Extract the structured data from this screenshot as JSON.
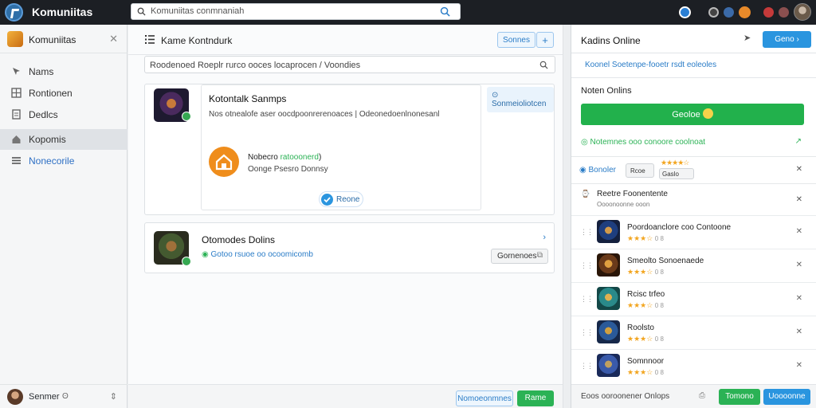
{
  "app": {
    "title": "Komuniitas",
    "search_text": "Komuniitas conmnaniah"
  },
  "sidebar": {
    "title": "Komuniitas",
    "items": [
      {
        "label": "Nams",
        "icon": "pointer-icon"
      },
      {
        "label": "Rontionen",
        "icon": "grid-icon"
      },
      {
        "label": "Dedlcs",
        "icon": "document-icon"
      },
      {
        "label": "Kopomis",
        "icon": "home-icon"
      },
      {
        "label": "Nonecorile",
        "icon": "list-icon"
      }
    ],
    "user": {
      "name": "Senmer"
    }
  },
  "main": {
    "title": "Kame Kontndurk",
    "header_button": "Sonnes",
    "header_plus": "+",
    "search_text": "Roodenoed Roeplr rurco ooces locaprocen / Voondies",
    "card1": {
      "title": "Kotontalk Sanmps",
      "description": "Nos otnealofe aser oocdpoonrerenoaces | Odeonedoenlnonesanl",
      "badge": "Sonmeioliotcen",
      "promo_title_prefix": "Nobecro ",
      "promo_title_link": "ratooonerd",
      "promo_title_suffix": ")",
      "promo_sub": "Oonge Psesro Donnsy",
      "chip": "Reone"
    },
    "card2": {
      "title": "Otomodes Dolins",
      "subtitle": "Gotoo rsuoe oo ocoomicomb",
      "button": "Gornenoes"
    },
    "footer_btn_secondary": "Nomoeonmnes",
    "footer_btn_primary": "Rame"
  },
  "right": {
    "title": "Kadins Online",
    "header_btn": "Geno",
    "search_text": "Koonel Soetenpe-fooetr rsdt eoleoles",
    "section_title": "Noten Onlins",
    "green_btn": "Geoloe",
    "status_text": "Notemnes ooo conoore coolnoat",
    "chip_label": "Bonoler",
    "chip_btn1": "Rcoe",
    "chip_btn2": "Gaslo",
    "item_hdr_title": "Reetre Foonentente",
    "item_hdr_sub": "Oooonoonne ooon",
    "items": [
      {
        "name": "Poordoanclore coo Contoone",
        "stars": "★★★☆",
        "score": "0 8"
      },
      {
        "name": "Smeolto Sonoenaede",
        "stars": "★★★☆",
        "score": "0 8"
      },
      {
        "name": "Rcisc trfeo",
        "stars": "★★★☆",
        "score": "0 8"
      },
      {
        "name": "Roolsto",
        "stars": "★★★☆",
        "score": "0 8"
      },
      {
        "name": "Somnnoor",
        "stars": "★★★☆",
        "score": "0 8"
      }
    ],
    "footer_text": "Eoos ooroonener Onlops",
    "footer_btn_green": "Tomono",
    "footer_btn_blue": "Uoooonne"
  },
  "colors": {
    "green": "#2bb255",
    "blue": "#2a95df",
    "orange": "#ef8d1c",
    "dark": "#1c1f24"
  }
}
